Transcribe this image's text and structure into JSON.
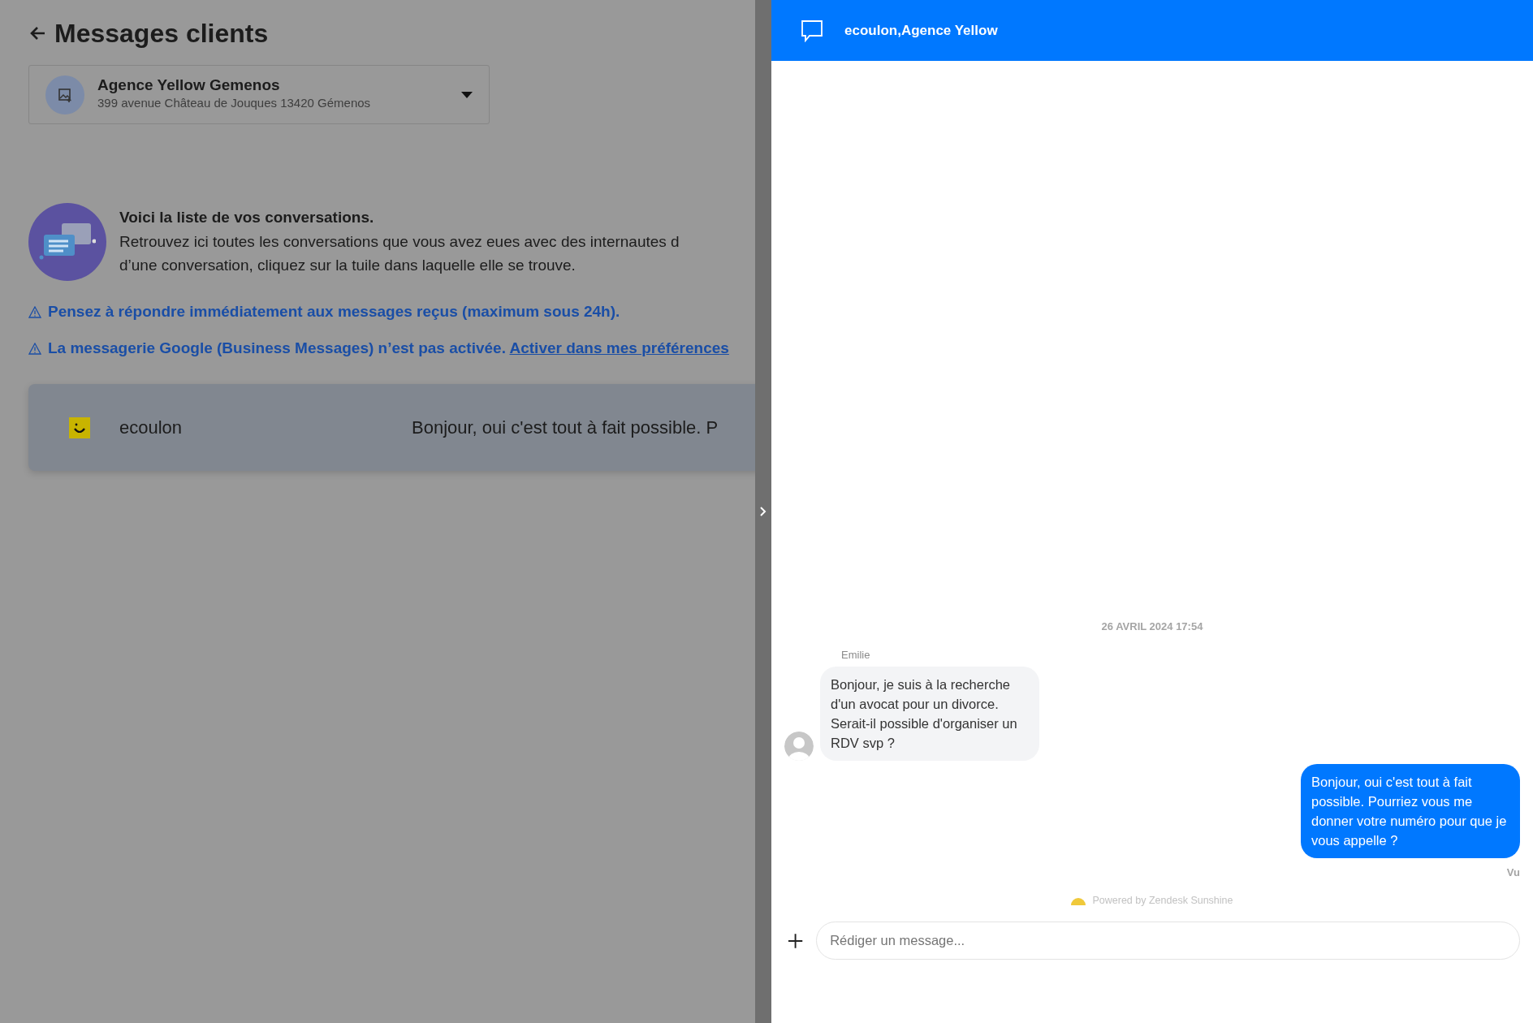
{
  "page": {
    "title": "Messages clients"
  },
  "location_select": {
    "name": "Agence Yellow Gemenos",
    "address": "399 avenue Château de Jouques 13420 Gémenos"
  },
  "intro": {
    "heading": "Voici la liste de vos conversations.",
    "lines": [
      "Retrouvez ici toutes les conversations que vous avez eues avec des internautes d",
      "d’une conversation, cliquez sur la tuile dans laquelle elle se trouve."
    ]
  },
  "notices": [
    {
      "text": "Pensez à répondre immédiatement aux messages reçus (maximum sous 24h)."
    },
    {
      "text": "La messagerie Google (Business Messages) n’est pas activée.",
      "link": "Activer dans mes préférences"
    }
  ],
  "conversations": [
    {
      "name": "ecoulon",
      "preview": "Bonjour, oui c'est tout à fait possible. P",
      "selected": true
    }
  ],
  "chat": {
    "title": "ecoulon,Agence Yellow",
    "date": "26 AVRIL 2024 17:54",
    "messages": [
      {
        "kind": "received",
        "author": "Emilie",
        "text": "Bonjour, je suis à la recherche d'un avocat pour un divorce. Serait-il possible d'organiser un RDV svp ?"
      },
      {
        "kind": "sent",
        "text": "Bonjour, oui c'est tout à fait possible. Pourriez vous me donner votre numéro pour que je vous appelle ?",
        "status": "Vu"
      }
    ],
    "powered_by": "Powered by Zendesk Sunshine",
    "composer": {
      "placeholder": "Rédiger un message..."
    }
  }
}
